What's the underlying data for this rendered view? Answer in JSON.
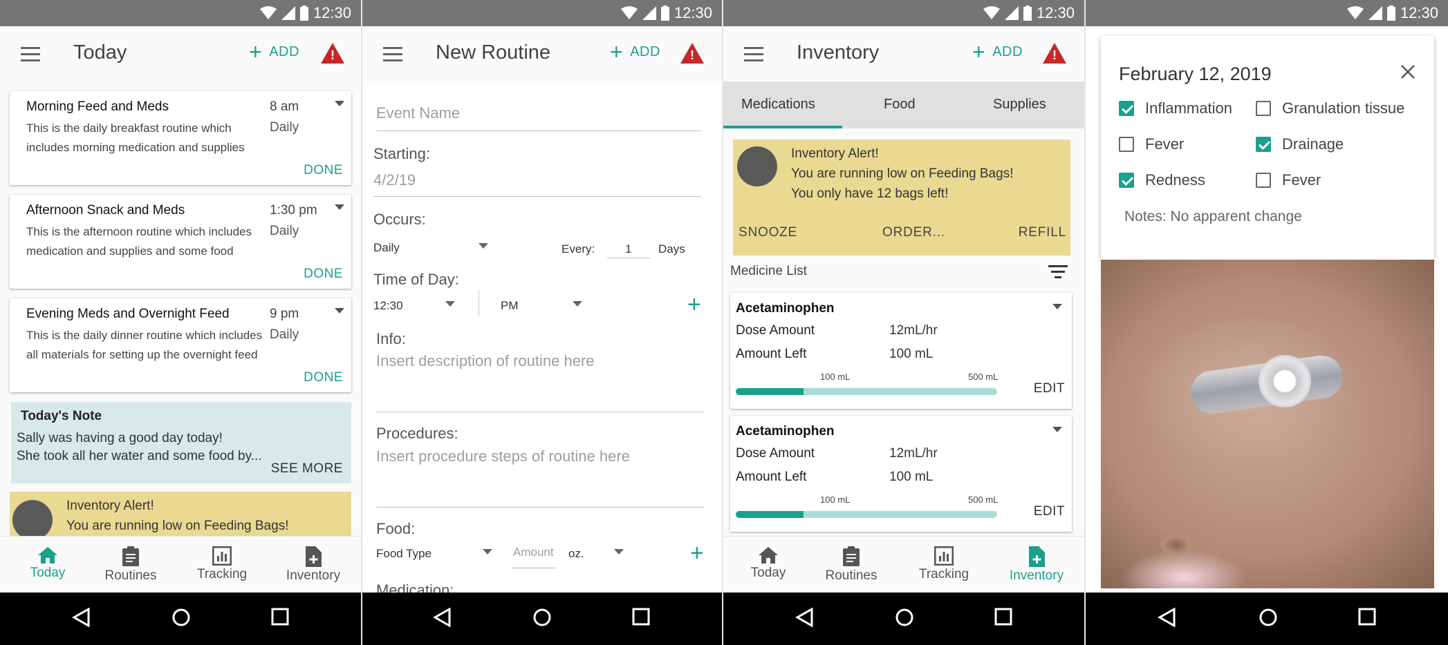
{
  "status": {
    "time": "12:30"
  },
  "colors": {
    "accent": "#1aa08b",
    "alert_bg": "#e9d991",
    "note_bg": "#d9e8e8",
    "warning": "#c62828"
  },
  "screen1": {
    "title": "Today",
    "add_label": "ADD",
    "cards": [
      {
        "title": "Morning Feed and Meds",
        "time": "8 am",
        "freq": "Daily",
        "desc": "This is the daily breakfast routine which includes morning medication and supplies",
        "action": "DONE"
      },
      {
        "title": "Afternoon Snack and Meds",
        "time": "1:30 pm",
        "freq": "Daily",
        "desc": "This is the afternoon routine which includes medication and supplies and some food",
        "action": "DONE"
      },
      {
        "title": "Evening Meds and Overnight Feed",
        "time": "9 pm",
        "freq": "Daily",
        "desc": "This is the daily dinner routine which includes all materials for setting up the overnight feed",
        "action": "DONE"
      }
    ],
    "note": {
      "title": "Today's Note",
      "line1": "Sally was having a good day today!",
      "line2": "She took all her water and some food by...",
      "more": "SEE MORE"
    },
    "alert": {
      "title": "Inventory Alert!",
      "line1": "You are running low on Feeding Bags!"
    }
  },
  "nav": {
    "today": "Today",
    "routines": "Routines",
    "tracking": "Tracking",
    "inventory": "Inventory"
  },
  "screen2": {
    "title": "New Routine",
    "add_label": "ADD",
    "event_name_placeholder": "Event Name",
    "starting_label": "Starting:",
    "starting_value": "4/2/19",
    "occurs_label": "Occurs:",
    "occurs_value": "Daily",
    "every_label": "Every:",
    "every_value": "1",
    "days_label": "Days",
    "time_label": "Time of Day:",
    "time_value": "12:30",
    "ampm_value": "PM",
    "info_label": "Info:",
    "info_placeholder": "Insert description of routine here",
    "procedures_label": "Procedures:",
    "procedures_placeholder": "Insert procedure steps of routine here",
    "food_label": "Food:",
    "food_type": "Food Type",
    "amount_placeholder": "Amount",
    "unit": "oz.",
    "medication_label": "Medication:"
  },
  "screen3": {
    "title": "Inventory",
    "add_label": "ADD",
    "tabs": [
      "Medications",
      "Food",
      "Supplies"
    ],
    "alert": {
      "title": "Inventory Alert!",
      "line1": "You are running low on Feeding Bags!",
      "line2": "You only have 12 bags left!",
      "snooze": "SNOOZE",
      "order": "ORDER...",
      "refill": "REFILL"
    },
    "list_title": "Medicine List",
    "meds": [
      {
        "name": "Acetaminophen",
        "dose_label": "Dose Amount",
        "dose": "12mL/hr",
        "left_label": "Amount Left",
        "left": "100 mL",
        "min_label": "100 mL",
        "max_label": "500 mL",
        "level": 0.26,
        "edit": "EDIT"
      },
      {
        "name": "Acetaminophen",
        "dose_label": "Dose Amount",
        "dose": "12mL/hr",
        "left_label": "Amount Left",
        "left": "100 mL",
        "min_label": "100 mL",
        "max_label": "500 mL",
        "level": 0.26,
        "edit": "EDIT"
      }
    ]
  },
  "screen4": {
    "date": "February 12, 2019",
    "checks": [
      {
        "label": "Inflammation",
        "checked": true
      },
      {
        "label": "Granulation tissue",
        "checked": false
      },
      {
        "label": "Fever",
        "checked": false
      },
      {
        "label": "Drainage",
        "checked": true
      },
      {
        "label": "Redness",
        "checked": true
      },
      {
        "label": "Fever",
        "checked": false
      }
    ],
    "notes": "Notes: No apparent change"
  }
}
